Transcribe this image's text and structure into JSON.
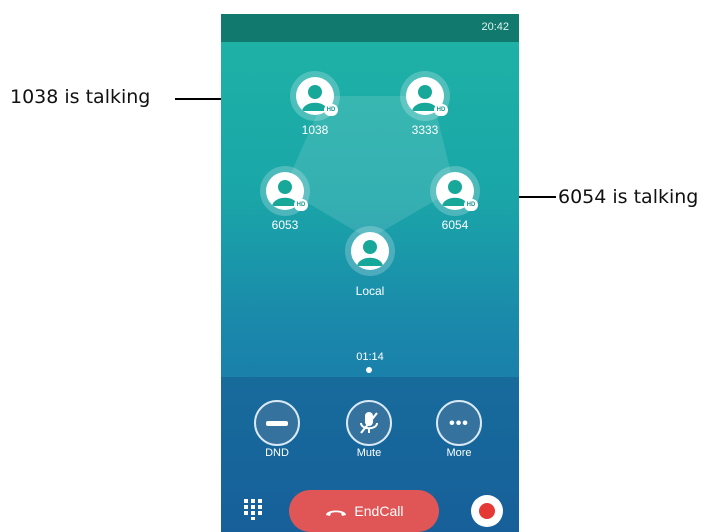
{
  "annotations": {
    "left": "1038 is talking",
    "right": "6054 is talking"
  },
  "status_bar": {
    "time": "20:42"
  },
  "conference": {
    "participants": [
      {
        "name": "1038",
        "hd": "HD"
      },
      {
        "name": "3333",
        "hd": "HD"
      },
      {
        "name": "6053",
        "hd": "HD"
      },
      {
        "name": "6054",
        "hd": "HD"
      },
      {
        "name": "Local"
      }
    ],
    "duration": "01:14"
  },
  "controls": {
    "dnd": "DND",
    "mute": "Mute",
    "more": "More"
  },
  "bottom_bar": {
    "end_call": "EndCall"
  },
  "colors": {
    "end_call": "#e05656",
    "record": "#e53935",
    "status_bar": "#12796f"
  }
}
